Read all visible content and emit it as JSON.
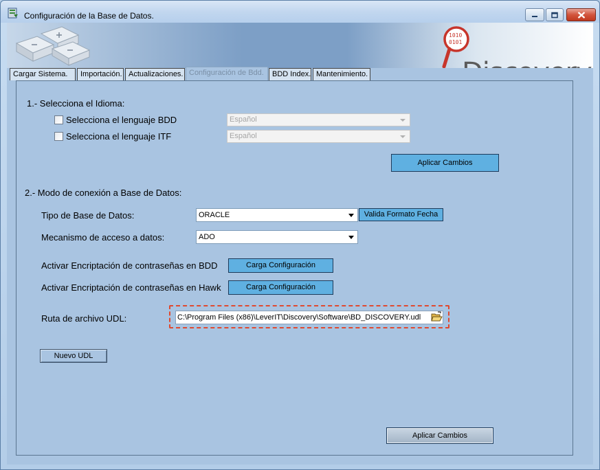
{
  "window": {
    "title": "Configuración de la Base de Datos."
  },
  "banner": {
    "logo_text": "Discovery",
    "logo_binary": [
      "1010",
      "0101"
    ]
  },
  "tabs": [
    {
      "label": "Cargar Sistema.",
      "active": false
    },
    {
      "label": "Importación.",
      "active": false
    },
    {
      "label": "Actualizaciones.",
      "active": false
    },
    {
      "label": "Configuración de Bdd.",
      "active": true
    },
    {
      "label": "BDD Index.",
      "active": false
    },
    {
      "label": "Mantenimiento.",
      "active": false
    }
  ],
  "idioma": {
    "heading": "1.- Selecciona el Idioma:",
    "bdd_label": "Selecciona el lenguaje BDD",
    "bdd_checked": false,
    "bdd_value": "Español",
    "itf_label": "Selecciona el lenguaje ITF",
    "itf_checked": false,
    "itf_value": "Español",
    "apply_label": "Aplicar Cambios"
  },
  "conexion": {
    "heading": "2.- Modo de conexión a Base de Datos:",
    "tipo_label": "Tipo de Base de Datos:",
    "tipo_value": "ORACLE",
    "valida_label": "Valida Formato Fecha",
    "mecanismo_label": "Mecanismo de acceso a datos:",
    "mecanismo_value": "ADO",
    "enc_bdd_label": "Activar Encriptación de contraseñas en BDD",
    "enc_hawk_label": "Activar Encriptación de contraseñas en Hawk",
    "carga_label": "Carga Configuración",
    "udl_label": "Ruta de archivo UDL:",
    "udl_value": "C:\\Program Files (x86)\\LeverIT\\Discovery\\Software\\BD_DISCOVERY.udl",
    "nuevo_udl_label": "Nuevo UDL",
    "apply_label": "Aplicar Cambios"
  },
  "colors": {
    "accent_button": "#5fb0e1",
    "panel_bg": "#a9c4e1",
    "highlight_dashed": "#e0492f"
  }
}
